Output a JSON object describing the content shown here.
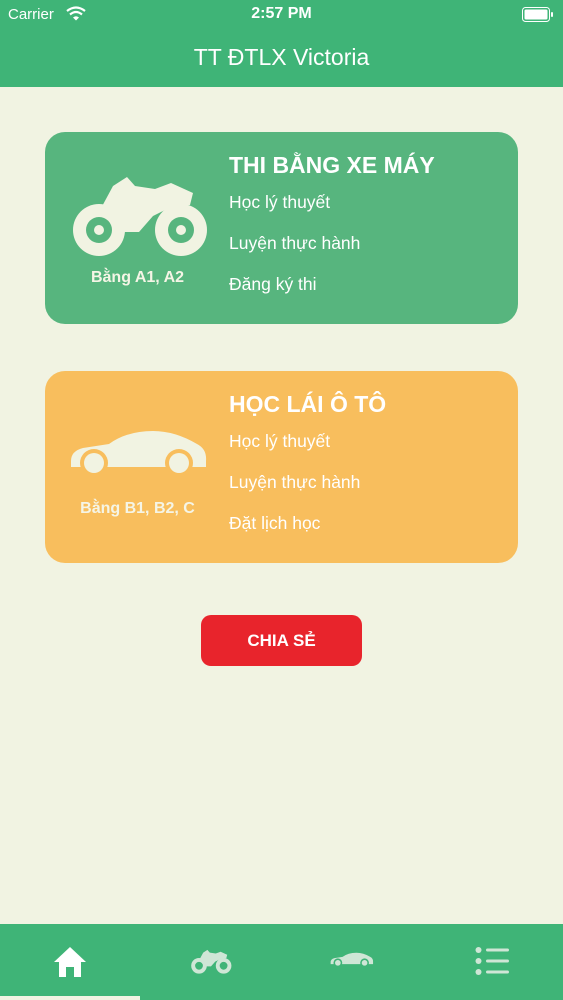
{
  "status_bar": {
    "carrier": "Carrier",
    "time": "2:57 PM"
  },
  "nav": {
    "title": "TT ĐTLX Victoria"
  },
  "cards": [
    {
      "title": "THI BẰNG XE MÁY",
      "caption": "Bằng A1, A2",
      "icon": "motorcycle-icon",
      "color": "#57b57e",
      "links": [
        "Học lý thuyết",
        "Luyện thực hành",
        "Đăng ký thi"
      ]
    },
    {
      "title": "HỌC LÁI Ô TÔ",
      "caption": "Bằng B1, B2, C",
      "icon": "car-icon",
      "color": "#f8be5d",
      "links": [
        "Học lý thuyết",
        "Luyện thực hành",
        "Đặt lịch học"
      ]
    }
  ],
  "share_button": {
    "label": "CHIA SẺ",
    "color": "#e8242c"
  },
  "tab_bar": {
    "selected_index": 0,
    "tabs": [
      {
        "icon": "home-icon"
      },
      {
        "icon": "motorcycle-icon"
      },
      {
        "icon": "car-icon"
      },
      {
        "icon": "list-icon"
      }
    ]
  },
  "colors": {
    "primary": "#3fb477",
    "background": "#f1f3e2"
  }
}
